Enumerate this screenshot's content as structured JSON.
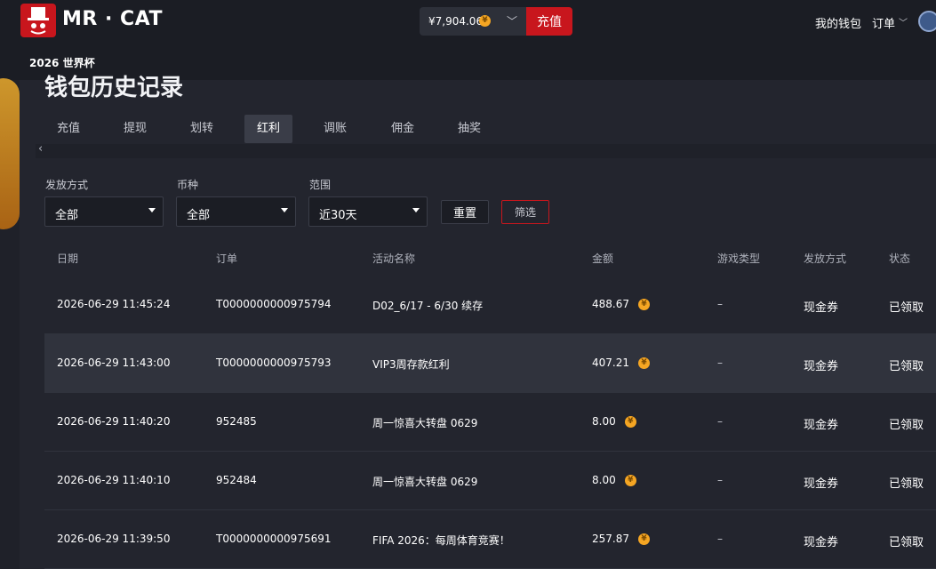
{
  "header": {
    "logo_text": "MR · CAT",
    "wallet_amount": "¥7,904.06",
    "deposit_label": "充值",
    "my_wallet": "我的钱包",
    "orders": "订单",
    "coin_glyph": "¥"
  },
  "subnav": {
    "label": "2026 世界杯"
  },
  "page": {
    "title": "钱包历史记录"
  },
  "tabs": [
    "充值",
    "提现",
    "划转",
    "红利",
    "调账",
    "佣金",
    "抽奖"
  ],
  "active_tab": "红利",
  "filters": {
    "method": {
      "label": "发放方式",
      "value": "全部"
    },
    "currency": {
      "label": "币种",
      "value": "全部"
    },
    "range": {
      "label": "范围",
      "value": "近30天"
    },
    "reset_label": "重置",
    "filter_label": "筛选"
  },
  "table": {
    "headers": [
      "日期",
      "订单",
      "活动名称",
      "金额",
      "游戏类型",
      "发放方式",
      "状态"
    ],
    "rows": [
      {
        "date": "2026-06-29 11:45:24",
        "order": "T0000000000975794",
        "activity": "D02_6/17 - 6/30 续存",
        "amount": "488.67",
        "game_type": "–",
        "method": "现金券",
        "status": "已领取"
      },
      {
        "date": "2026-06-29 11:43:00",
        "order": "T0000000000975793",
        "activity": "VIP3周存款红利",
        "amount": "407.21",
        "game_type": "–",
        "method": "现金券",
        "status": "已领取"
      },
      {
        "date": "2026-06-29 11:40:20",
        "order": "952485",
        "activity": "周一惊喜大转盘 0629",
        "amount": "8.00",
        "game_type": "–",
        "method": "现金券",
        "status": "已领取"
      },
      {
        "date": "2026-06-29 11:40:10",
        "order": "952484",
        "activity": "周一惊喜大转盘 0629",
        "amount": "8.00",
        "game_type": "–",
        "method": "现金券",
        "status": "已领取"
      },
      {
        "date": "2026-06-29 11:39:50",
        "order": "T0000000000975691",
        "activity": "FIFA 2026：每周体育竞赛！",
        "amount": "257.87",
        "game_type": "–",
        "method": "现金券",
        "status": "已领取"
      }
    ]
  },
  "colors": {
    "brand_red": "#c8161d",
    "coin_gold": "#f5a623",
    "background": "#23252e"
  },
  "icons": [
    "cat-logo-icon",
    "coin-icon",
    "chevron-down-icon",
    "avatar-icon",
    "chevron-left-icon",
    "caret-down-icon"
  ]
}
